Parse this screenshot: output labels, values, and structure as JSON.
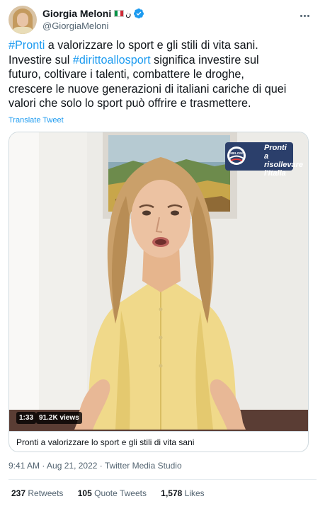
{
  "header": {
    "display_name": "Giorgia Meloni",
    "handle": "@GiorgiaMeloni",
    "name_glyph": "ن",
    "flag_colors": [
      "#009246",
      "#ffffff",
      "#ce2b37"
    ],
    "verified_color": "#1d9bf0"
  },
  "tweet": {
    "hashtag_1": "#Pronti",
    "line1_rest": " a valorizzare lo sport e gli stili di vita sani.",
    "line2_pre": "Investire sul ",
    "hashtag_2": "#dirittoallosport",
    "line2_post": " significa investire sul",
    "line3": "futuro, coltivare i talenti, combattere le droghe,",
    "line4": "crescere le nuove generazioni di italiani cariche di quei",
    "line5": "valori che solo lo sport può offrire e trasmettere.",
    "translate_label": "Translate Tweet",
    "link_color": "#1d9bf0"
  },
  "media": {
    "duration": "1:33",
    "views": "91.2K views",
    "overlay_brand": "MELONI",
    "overlay_line1": "Pronti",
    "overlay_line2": "a risollevare",
    "overlay_line3": "l'Italia",
    "card_title": "Pronti a valorizzare lo sport e gli stili di vita sani"
  },
  "meta": {
    "time": "9:41 AM",
    "date": "Aug 21, 2022",
    "source": "Twitter Media Studio",
    "separator": "·"
  },
  "stats": {
    "retweets_count": "237",
    "retweets_label": "Retweets",
    "quotes_count": "105",
    "quotes_label": "Quote Tweets",
    "likes_count": "1,578",
    "likes_label": "Likes"
  }
}
